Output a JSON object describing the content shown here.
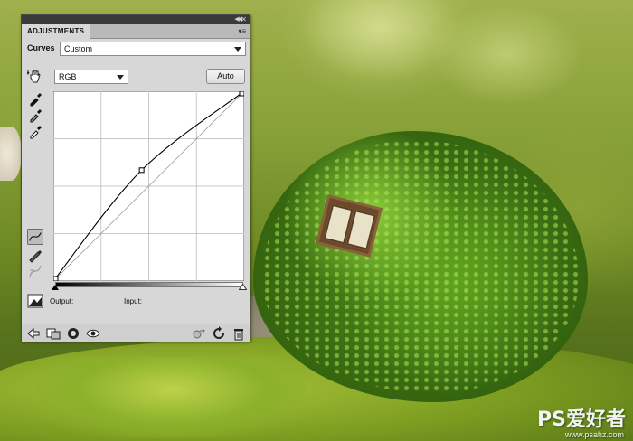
{
  "panel": {
    "tab_label": "ADJUSTMENTS",
    "adjustment_type": "Curves",
    "preset_value": "Custom",
    "channel_value": "RGB",
    "auto_label": "Auto",
    "output_label": "Output:",
    "input_label": "Input:",
    "curve": {
      "points": [
        [
          0,
          0
        ],
        [
          118,
          149
        ],
        [
          255,
          255
        ]
      ],
      "range": [
        0,
        255
      ]
    }
  },
  "watermark": {
    "logo_text": "PS爱好者",
    "url_text": "www.psahz.com"
  }
}
